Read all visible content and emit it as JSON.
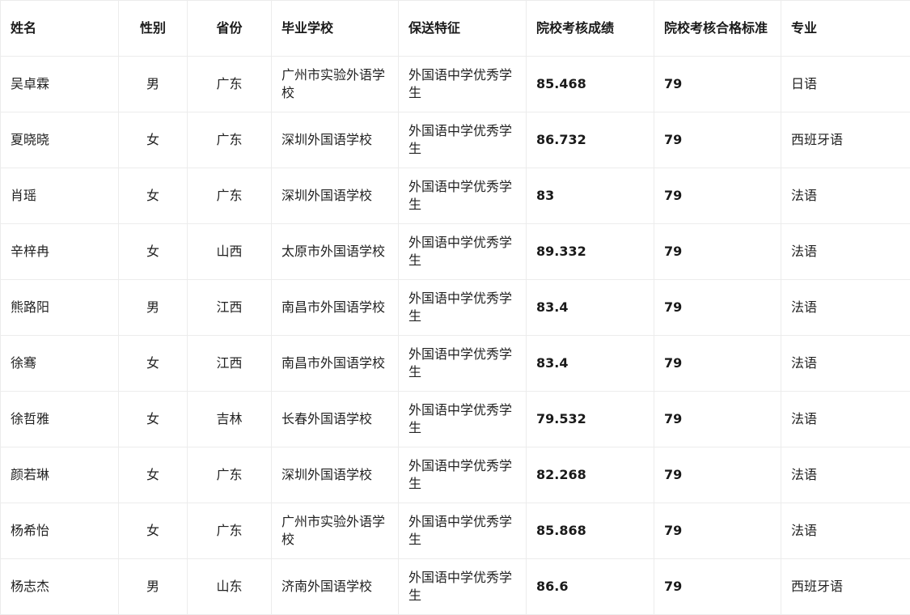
{
  "table": {
    "headers": [
      "姓名",
      "性别",
      "省份",
      "毕业学校",
      "保送特征",
      "院校考核成绩",
      "院校考核合格标准",
      "专业"
    ],
    "rows": [
      [
        "吴卓霖",
        "男",
        "广东",
        "广州市实验外语学校",
        "外国语中学优秀学生",
        "85.468",
        "79",
        "日语"
      ],
      [
        "夏晓晓",
        "女",
        "广东",
        "深圳外国语学校",
        "外国语中学优秀学生",
        "86.732",
        "79",
        "西班牙语"
      ],
      [
        "肖瑶",
        "女",
        "广东",
        "深圳外国语学校",
        "外国语中学优秀学生",
        "83",
        "79",
        "法语"
      ],
      [
        "辛梓冉",
        "女",
        "山西",
        "太原市外国语学校",
        "外国语中学优秀学生",
        "89.332",
        "79",
        "法语"
      ],
      [
        "熊路阳",
        "男",
        "江西",
        "南昌市外国语学校",
        "外国语中学优秀学生",
        "83.4",
        "79",
        "法语"
      ],
      [
        "徐骞",
        "女",
        "江西",
        "南昌市外国语学校",
        "外国语中学优秀学生",
        "83.4",
        "79",
        "法语"
      ],
      [
        "徐哲雅",
        "女",
        "吉林",
        "长春外国语学校",
        "外国语中学优秀学生",
        "79.532",
        "79",
        "法语"
      ],
      [
        "颜若琳",
        "女",
        "广东",
        "深圳外国语学校",
        "外国语中学优秀学生",
        "82.268",
        "79",
        "法语"
      ],
      [
        "杨希怡",
        "女",
        "广东",
        "广州市实验外语学校",
        "外国语中学优秀学生",
        "85.868",
        "79",
        "法语"
      ],
      [
        "杨志杰",
        "男",
        "山东",
        "济南外国语学校",
        "外国语中学优秀学生",
        "86.6",
        "79",
        "西班牙语"
      ]
    ]
  }
}
